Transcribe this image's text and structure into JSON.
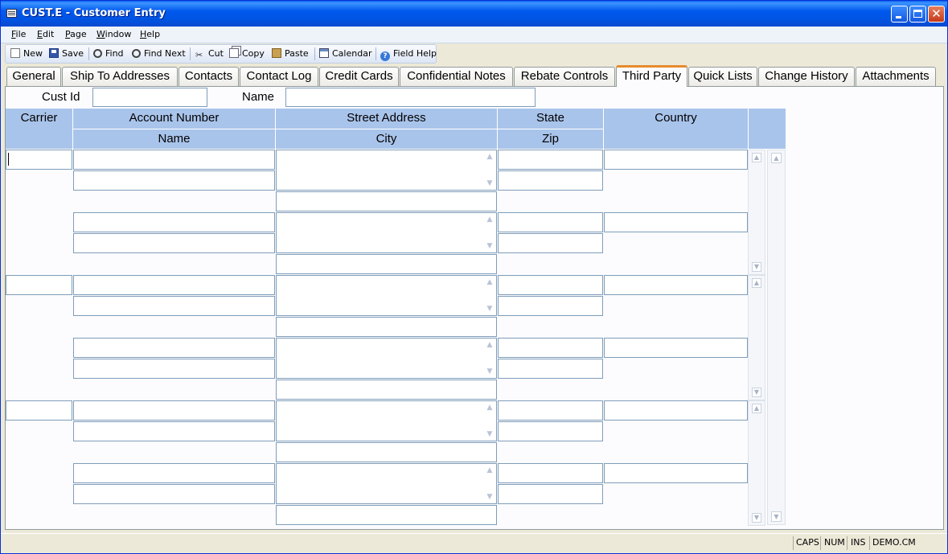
{
  "window": {
    "title": "CUST.E - Customer Entry"
  },
  "menu": [
    {
      "label": "File",
      "key": "F",
      "rest": "ile"
    },
    {
      "label": "Edit",
      "key": "E",
      "rest": "dit"
    },
    {
      "label": "Page",
      "key": "P",
      "rest": "age"
    },
    {
      "label": "Window",
      "key": "W",
      "rest": "indow"
    },
    {
      "label": "Help",
      "key": "H",
      "rest": "elp"
    }
  ],
  "toolbar": {
    "new": "New",
    "save": "Save",
    "find": "Find",
    "find_next": "Find Next",
    "cut": "Cut",
    "copy": "Copy",
    "paste": "Paste",
    "calendar": "Calendar",
    "field_help": "Field Help"
  },
  "tabs": [
    {
      "label": "General",
      "active": false
    },
    {
      "label": "Ship To Addresses",
      "active": false
    },
    {
      "label": "Contacts",
      "active": false
    },
    {
      "label": "Contact Log",
      "active": false
    },
    {
      "label": "Credit Cards",
      "active": false
    },
    {
      "label": "Confidential Notes",
      "active": false
    },
    {
      "label": "Rebate Controls",
      "active": false
    },
    {
      "label": "Third Party",
      "active": true
    },
    {
      "label": "Quick Lists",
      "active": false
    },
    {
      "label": "Change History",
      "active": false
    },
    {
      "label": "Attachments",
      "active": false
    }
  ],
  "form": {
    "cust_id_label": "Cust Id",
    "cust_id_value": "",
    "name_label": "Name",
    "name_value": ""
  },
  "grid": {
    "headers": {
      "carrier": "Carrier",
      "account_number": "Account Number",
      "street_address": "Street Address",
      "state": "State",
      "country": "Country",
      "name": "Name",
      "city": "City",
      "zip": "Zip"
    }
  },
  "status": {
    "caps": "CAPS",
    "num": "NUM",
    "ins": "INS",
    "db": "DEMO.CM"
  }
}
